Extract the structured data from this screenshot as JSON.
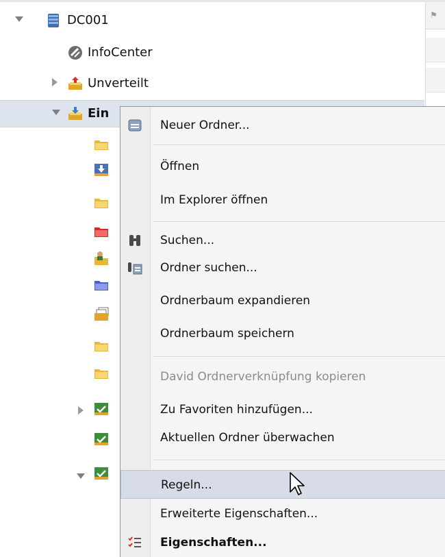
{
  "tree": {
    "root": {
      "label": "DC001",
      "icon": "database-icon"
    },
    "items": [
      {
        "label": "InfoCenter",
        "icon": "infocenter-icon"
      },
      {
        "label": "Unverteilt",
        "icon": "unassigned-inbox-icon"
      },
      {
        "label": "Ein",
        "icon": "inbox-icon"
      }
    ],
    "child_icons": [
      "yellow-folder-icon",
      "download-folder-icon",
      "yellow-folder-icon",
      "red-folder-icon",
      "user-folder-icon",
      "blue-folder-icon",
      "stacked-pages-folder-icon",
      "yellow-folder-icon",
      "yellow-folder-icon",
      "green-folder-icon",
      "green-folder-icon",
      "green-folder-icon"
    ]
  },
  "column": {
    "flag_icon": "flag-icon"
  },
  "menu": {
    "items": [
      {
        "label": "Neuer Ordner...",
        "icon": "new-folder-icon"
      },
      {
        "label": "Öffnen"
      },
      {
        "label": "Im Explorer öffnen"
      },
      {
        "label": "Suchen...",
        "icon": "binoculars-icon"
      },
      {
        "label": "Ordner suchen...",
        "icon": "folder-search-icon"
      },
      {
        "label": "Ordnerbaum expandieren"
      },
      {
        "label": "Ordnerbaum speichern"
      },
      {
        "label": "David Ordnerverknüpfung kopieren",
        "state": "disabled"
      },
      {
        "label": "Zu Favoriten hinzufügen..."
      },
      {
        "label": "Aktuellen Ordner überwachen"
      },
      {
        "label": "Regeln...",
        "state": "hover"
      },
      {
        "label": "Erweiterte Eigenschaften..."
      },
      {
        "label": "Eigenschaften...",
        "icon": "properties-checklist-icon",
        "style": "bold"
      }
    ]
  },
  "colors": {
    "selection": "#dde4ee",
    "menu_hover": "#d8dce8",
    "menu_background": "#f5f5f5",
    "disabled_text": "#8b8b8b"
  }
}
